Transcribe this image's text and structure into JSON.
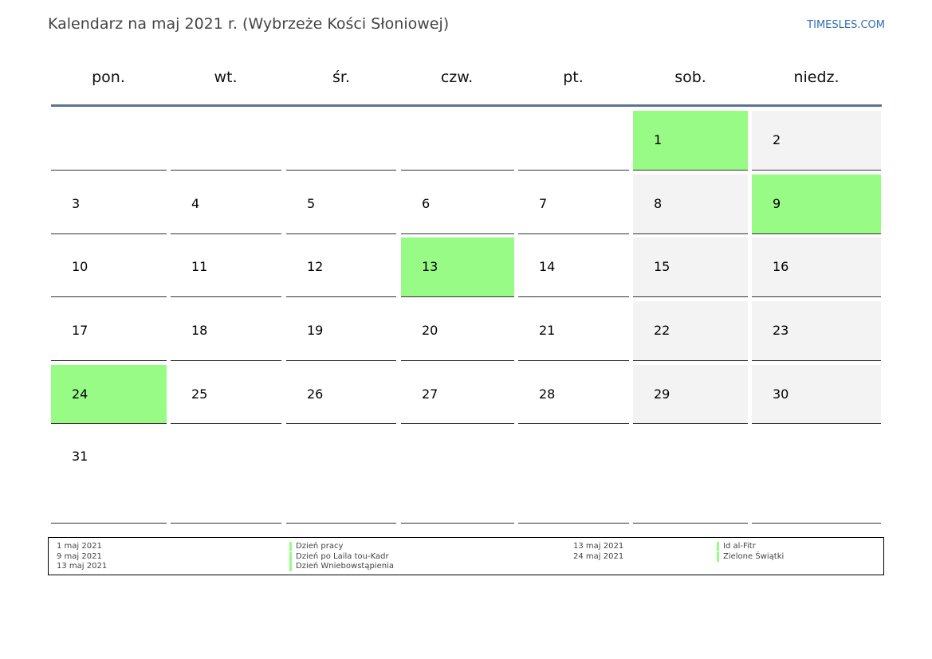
{
  "title": "Kalendarz na maj 2021 r. (Wybrzeże Kości Słoniowej)",
  "brand": "TIMESLES.COM",
  "weekdays": [
    "pon.",
    "wt.",
    "śr.",
    "czw.",
    "pt.",
    "sob.",
    "niedz."
  ],
  "calendar": {
    "month": "maj 2021",
    "weeks": [
      [
        "",
        "",
        "",
        "",
        "",
        "1",
        "2"
      ],
      [
        "3",
        "4",
        "5",
        "6",
        "7",
        "8",
        "9"
      ],
      [
        "10",
        "11",
        "12",
        "13",
        "14",
        "15",
        "16"
      ],
      [
        "17",
        "18",
        "19",
        "20",
        "21",
        "22",
        "23"
      ],
      [
        "24",
        "25",
        "26",
        "27",
        "28",
        "29",
        "30"
      ],
      [
        "31",
        "",
        "",
        "",
        "",
        "",
        ""
      ]
    ],
    "holiday_days": [
      "1",
      "9",
      "13",
      "24"
    ],
    "weekend_columns": [
      5,
      6
    ]
  },
  "colors": {
    "holiday": "#98fb86",
    "weekend": "#f3f3f3",
    "header_rule": "#5b7393",
    "brand": "#2f6fb3"
  },
  "legend": {
    "left_dates": [
      "1 maj 2021",
      "9 maj 2021",
      "13 maj 2021"
    ],
    "left_names": [
      "Dzień pracy",
      "Dzień po Laila tou-Kadr",
      "Dzień Wniebowstąpienia"
    ],
    "right_dates": [
      "13 maj 2021",
      "24 maj 2021"
    ],
    "right_names": [
      "Id al-Fitr",
      "Zielone Świątki"
    ]
  }
}
